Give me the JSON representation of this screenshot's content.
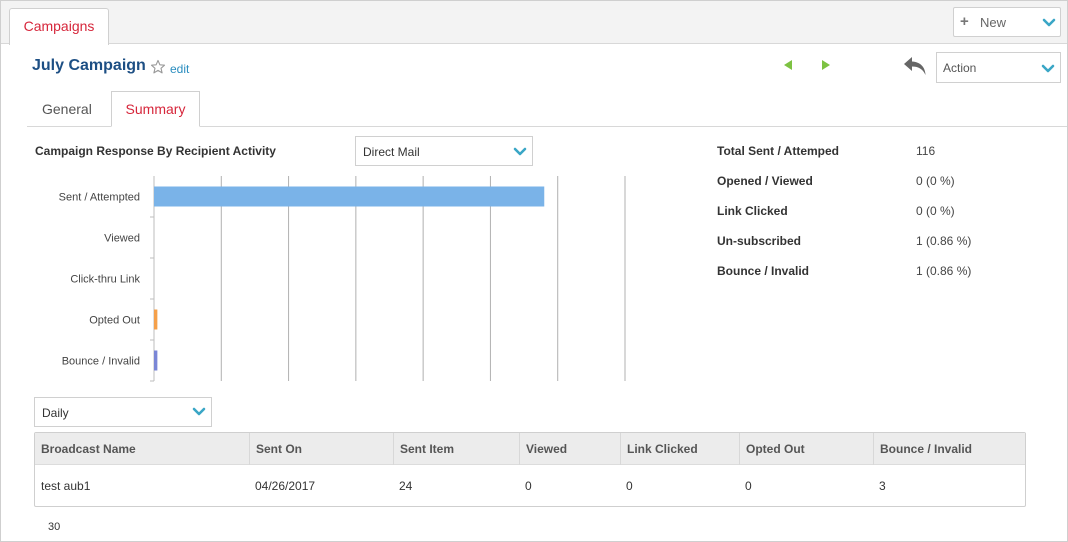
{
  "tabs": {
    "main": "Campaigns"
  },
  "header": {
    "new_label": "New",
    "title": "July Campaign",
    "edit_label": "edit",
    "action_label": "Action"
  },
  "subtabs": {
    "general": "General",
    "summary": "Summary"
  },
  "chart_section": {
    "title": "Campaign Response By Recipient Activity",
    "channel_select": "Direct Mail"
  },
  "chart_data": {
    "type": "bar",
    "orientation": "horizontal",
    "categories": [
      "Sent / Attempted",
      "Viewed",
      "Click-thru Link",
      "Opted Out",
      "Bounce / Invalid"
    ],
    "values": [
      116,
      0,
      0,
      1,
      1
    ],
    "colors": [
      "#7ab3e8",
      "#7ab3e8",
      "#7ab3e8",
      "#f5a04a",
      "#7a86d6"
    ],
    "xlim": [
      0,
      140
    ],
    "grid": true
  },
  "stats": [
    {
      "label": "Total Sent / Attemped",
      "value": "116"
    },
    {
      "label": "Opened / Viewed",
      "value": "0 (0 %)"
    },
    {
      "label": "Link Clicked",
      "value": "0 (0 %)"
    },
    {
      "label": "Un-subscribed",
      "value": "1 (0.86 %)"
    },
    {
      "label": "Bounce / Invalid",
      "value": "1 (0.86 %)"
    }
  ],
  "period_select": "Daily",
  "table": {
    "columns": [
      "Broadcast Name",
      "Sent On",
      "Sent Item",
      "Viewed",
      "Link Clicked",
      "Opted Out",
      "Bounce / Invalid"
    ],
    "rows": [
      [
        "test aub1",
        "04/26/2017",
        "24",
        "0",
        "0",
        "0",
        "3"
      ]
    ]
  },
  "footer_number": "30",
  "colors": {
    "accent_red": "#d6263b",
    "title_blue": "#1d4f84",
    "link_blue": "#2a8dbf",
    "nav_green": "#7dc242",
    "chevron_teal": "#3aa6c6"
  }
}
